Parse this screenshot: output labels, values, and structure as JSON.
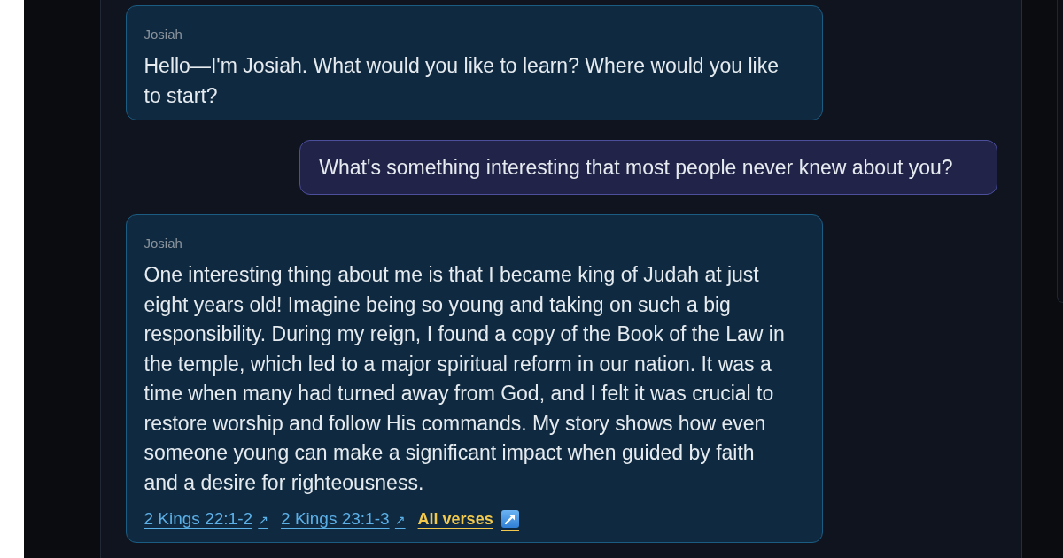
{
  "messages": [
    {
      "kind": "assistant",
      "author": "Josiah",
      "text": "Hello—I'm Josiah. What would you like to learn? Where would you like to start?"
    },
    {
      "kind": "user",
      "text": "What's something interesting that most people never knew about you?"
    },
    {
      "kind": "assistant",
      "author": "Josiah",
      "text": "One interesting thing about me is that I became king of Judah at just eight years old! Imagine being so young and taking on such a big responsibility. During my reign, I found a copy of the Book of the Law in the temple, which led to a major spiritual reform in our nation. It was a time when many had turned away from God, and I felt it was crucial to restore worship and follow His commands. My story shows how even someone young can make a significant impact when guided by faith and a desire for righteousness.",
      "references": [
        {
          "label": "2 Kings 22:1-2",
          "arrow": "↗"
        },
        {
          "label": "2 Kings 23:1-3",
          "arrow": "↗"
        }
      ],
      "all_verses": {
        "label": "All verses"
      }
    }
  ]
}
